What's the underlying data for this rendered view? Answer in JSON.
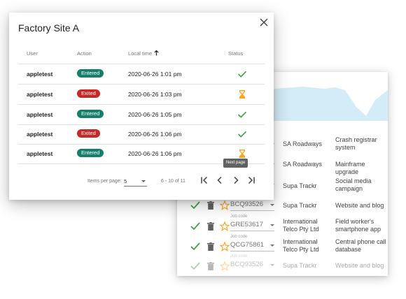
{
  "dialog": {
    "title": "Factory Site A",
    "columns": {
      "user": "User",
      "action": "Action",
      "local_time": "Local time",
      "status": "Status"
    },
    "rows": [
      {
        "user": "appletest",
        "action": "Entered",
        "action_color": "#14806b",
        "time": "2020-06-26 1:01 pm",
        "status": "check-icon"
      },
      {
        "user": "appletest",
        "action": "Exited",
        "action_color": "#c62828",
        "time": "2020-06-26 1:03 pm",
        "status": "hourglass-icon"
      },
      {
        "user": "appletest",
        "action": "Entered",
        "action_color": "#14806b",
        "time": "2020-06-26 1:05 pm",
        "status": "check-icon"
      },
      {
        "user": "appletest",
        "action": "Exited",
        "action_color": "#c62828",
        "time": "2020-06-26 1:06 pm",
        "status": "check-icon"
      },
      {
        "user": "appletest",
        "action": "Entered",
        "action_color": "#14806b",
        "time": "2020-06-26 1:06 pm",
        "status": "hourglass-icon"
      }
    ],
    "tooltip": "Next page",
    "pagination": {
      "items_per_page_label": "Items per page:",
      "items_per_page_value": "5",
      "range": "6 - 10 of 11"
    }
  },
  "background_card": {
    "rows": [
      {
        "job_code_label": "",
        "job_code": "",
        "company": "SA Roadways",
        "project": "Crash registrar system"
      },
      {
        "job_code_label": "",
        "job_code": "",
        "company": "SA Roadways",
        "project": "Mainframe upgrade"
      },
      {
        "job_code_label": "",
        "job_code": "",
        "company": "Supa Trackr",
        "project": "Social media campaign"
      },
      {
        "job_code_label": "",
        "job_code": "BCQ93526",
        "company": "Supa Trackr",
        "project": "Website and blog"
      },
      {
        "job_code_label": "Job code",
        "job_code": "GRE53617",
        "company": "International Telco Pty Ltd",
        "project": "Field worker's smartphone app"
      },
      {
        "job_code_label": "Job code",
        "job_code": "QCG75861",
        "company": "International Telco Pty Ltd",
        "project": "Central phone call database"
      },
      {
        "job_code_label": "Job code",
        "job_code": "BCQ93526",
        "company": "Supa Trackr",
        "project": "Website and blog"
      }
    ]
  },
  "colors": {
    "check": "#43a047",
    "hourglass": "#f9a825",
    "chart_fill": "#d4ecf7",
    "star": "#f9a825"
  }
}
